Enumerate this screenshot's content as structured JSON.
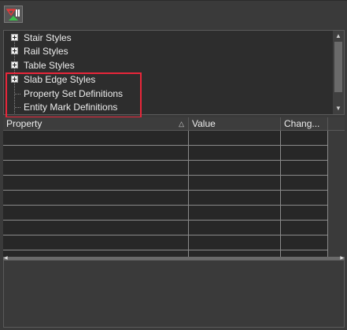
{
  "toolbar": {
    "filter_icon": "filter-clear-icon"
  },
  "tree": {
    "items": [
      {
        "label": "Stair Styles",
        "expandable": true
      },
      {
        "label": "Rail Styles",
        "expandable": true
      },
      {
        "label": "Table Styles",
        "expandable": true
      },
      {
        "label": "Slab Edge Styles",
        "expandable": true
      },
      {
        "label": "Property Set Definitions",
        "expandable": false
      },
      {
        "label": "Entity Mark Definitions",
        "expandable": false
      }
    ],
    "highlight_color": "#e8263a"
  },
  "grid": {
    "columns": [
      "Property",
      "Value",
      "Chang..."
    ],
    "sorted_column": "Property",
    "sort_icon": "sort-ascending-icon",
    "empty_row_count": 8
  },
  "colors": {
    "background": "#3a3a3a",
    "panel": "#2d2d2d",
    "grid_background": "#272727",
    "grid_lines": "#8a8a8a"
  }
}
